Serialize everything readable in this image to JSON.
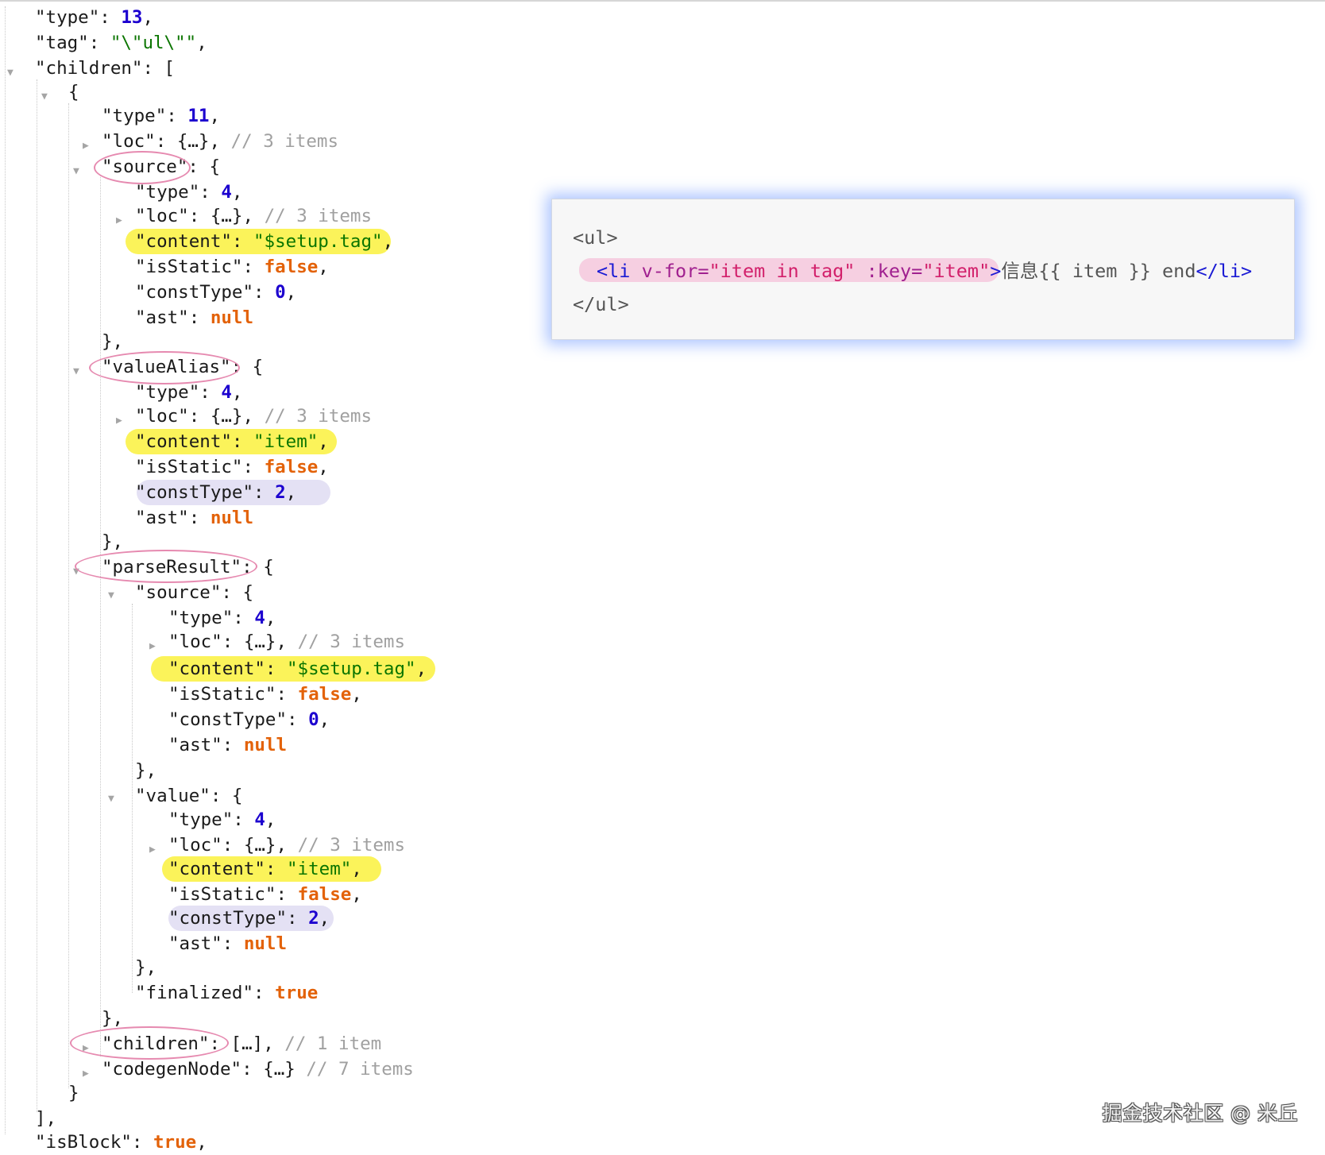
{
  "json_tree": {
    "type_key": "\"type\"",
    "type_value": "13",
    "tag_key": "\"tag\"",
    "tag_value": "\"\\\"ul\\\"\"",
    "children_key": "\"children\"",
    "item": {
      "type_value": "11",
      "loc_summary": "// 3 items",
      "source": {
        "key": "\"source\"",
        "type_value": "4",
        "loc_summary": "// 3 items",
        "content_value": "\"$setup.tag\"",
        "isStatic": "false",
        "constType": "0",
        "ast": "null"
      },
      "valueAlias": {
        "key": "\"valueAlias\"",
        "type_value": "4",
        "loc_summary": "// 3 items",
        "content_value": "\"item\"",
        "isStatic": "false",
        "constType": "2",
        "ast": "null"
      },
      "parseResult": {
        "key": "\"parseResult\"",
        "source": {
          "type_value": "4",
          "loc_summary": "// 3 items",
          "content_value": "\"$setup.tag\"",
          "isStatic": "false",
          "constType": "0",
          "ast": "null"
        },
        "value": {
          "type_value": "4",
          "loc_summary": "// 3 items",
          "content_value": "\"item\"",
          "isStatic": "false",
          "constType": "2",
          "ast": "null"
        },
        "finalized": "true"
      },
      "children_summary": "// 1 item",
      "codegenNode_summary": "// 7 items"
    },
    "isBlock_value": "true"
  },
  "template_card": {
    "ul_open": "<ul>",
    "li_open": "<li",
    "vfor_attr": "v-for=",
    "vfor_value": "\"item in tag\"",
    "key_attr": ":key=",
    "key_value": "\"item\"",
    "li_close_bracket": ">",
    "li_text": "信息{{ item }} end",
    "li_close": "</li>",
    "ul_close": "</ul>"
  },
  "watermark": "掘金技术社区 @ 米丘",
  "colors": {
    "highlight_yellow": "#fbf35a",
    "highlight_purple": "#e4e1f4",
    "circle_pink": "#e68ab0",
    "card_glow": "#4a7eff",
    "number_blue": "#1c00cf",
    "literal_orange": "#e36209",
    "string_green": "#0b7500"
  }
}
